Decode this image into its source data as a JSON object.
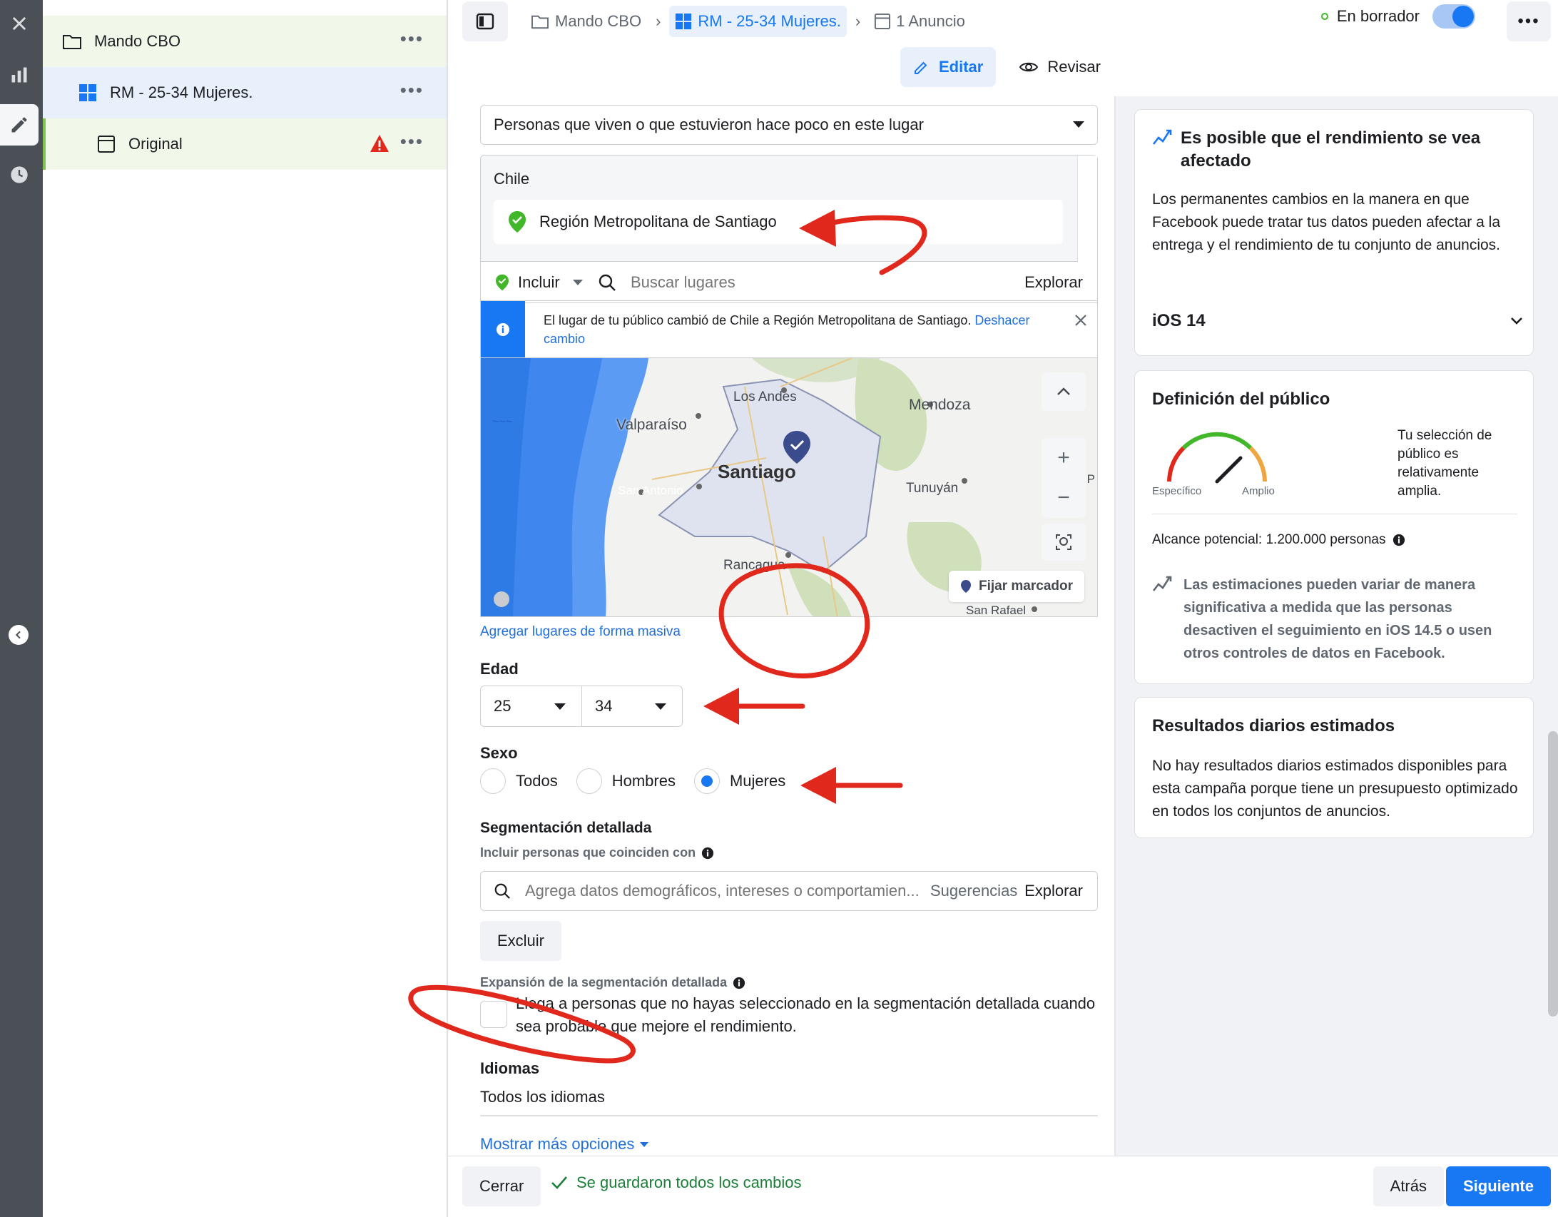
{
  "tree": {
    "campaign": "Mando CBO",
    "adset": "RM - 25-34 Mujeres.",
    "ad": "Original",
    "more": "•••"
  },
  "topbar": {
    "crumb_campaign": "Mando CBO",
    "crumb_adset": "RM - 25-34 Mujeres.",
    "crumb_ad": "1 Anuncio",
    "status": "En borrador",
    "more": "•••",
    "mode_edit": "Editar",
    "mode_review": "Revisar"
  },
  "location": {
    "type_select": "Personas que viven o que estuvieron hace poco en este lugar",
    "country": "Chile",
    "included_region": "Región Metropolitana de Santiago",
    "include_label": "Incluir",
    "search_placeholder": "Buscar lugares",
    "explore": "Explorar",
    "notice_text": "El lugar de tu público cambió de Chile a Región Metropolitana de Santiago.",
    "notice_undo": "Deshacer cambio",
    "map_labels": {
      "los_andes": "Los Andes",
      "valparaiso": "Valparaíso",
      "mendoza": "Mendoza",
      "santiago": "Santiago",
      "san_antonio": "San Antonio",
      "tunuyan": "Tunuyán",
      "la_p": "La P",
      "rancagua": "Rancagua",
      "san_rafael": "San Rafael"
    },
    "pin_marker": "Fijar marcador",
    "bulk_link": "Agregar lugares de forma masiva"
  },
  "age": {
    "label": "Edad",
    "min": "25",
    "max": "34"
  },
  "gender": {
    "label": "Sexo",
    "options": [
      "Todos",
      "Hombres",
      "Mujeres"
    ],
    "selected": "Mujeres"
  },
  "detailed": {
    "label": "Segmentación detallada",
    "include_label": "Incluir personas que coinciden con",
    "placeholder": "Agrega datos demográficos, intereses o comportamien...",
    "suggestions": "Sugerencias",
    "explore": "Explorar",
    "exclude": "Excluir",
    "expansion_label": "Expansión de la segmentación detallada",
    "expansion_text": "Llega a personas que no hayas seleccionado en la segmentación detallada cuando sea probable que mejore el rendimiento.",
    "expansion_checked": false
  },
  "languages": {
    "label": "Idiomas",
    "value": "Todos los idiomas",
    "more_options": "Mostrar más opciones"
  },
  "cards": {
    "ios": {
      "title": "Es posible que el rendimiento se vea afectado",
      "body": "Los permanentes cambios en la manera en que Facebook puede tratar tus datos pueden afectar a la entrega y el rendimiento de tu conjunto de anuncios.",
      "section": "iOS 14"
    },
    "audience": {
      "title": "Definición del público",
      "gauge_left": "Específico",
      "gauge_right": "Amplio",
      "gauge_level": 0.62,
      "gauge_text": "Tu selección de público es relativamente amplia.",
      "reach": "Alcance potencial: 1.200.000 personas",
      "note": "Las estimaciones pueden variar de manera significativa a medida que las personas desactiven el seguimiento en iOS 14.5 o usen otros controles de datos en Facebook."
    },
    "daily": {
      "title": "Resultados diarios estimados",
      "body": "No hay resultados diarios estimados disponibles para esta campaña porque tiene un presupuesto optimizado en todos los conjuntos de anuncios."
    }
  },
  "bottom": {
    "close": "Cerrar",
    "saved": "Se guardaron todos los cambios",
    "back": "Atrás",
    "next": "Siguiente"
  },
  "colors": {
    "primary": "#1877f2",
    "annotation": "#e0281c",
    "success": "#42b72a"
  }
}
